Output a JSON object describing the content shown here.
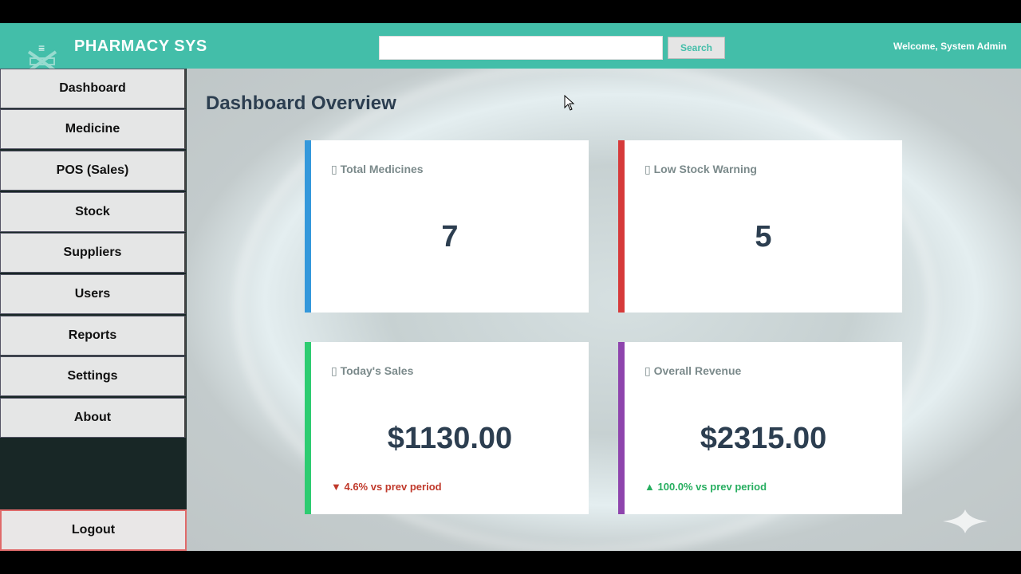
{
  "header": {
    "app_title": "PHARMACY SYS",
    "search_placeholder": "",
    "search_value": "",
    "search_label": "Search",
    "welcome": "Welcome, System Admin"
  },
  "sidebar": {
    "items": [
      {
        "label": "Dashboard"
      },
      {
        "label": "Medicine"
      },
      {
        "label": "POS (Sales)"
      },
      {
        "label": "Stock"
      },
      {
        "label": "Suppliers"
      },
      {
        "label": "Users"
      },
      {
        "label": "Reports"
      },
      {
        "label": "Settings"
      },
      {
        "label": "About"
      }
    ],
    "logout_label": "Logout"
  },
  "main": {
    "title": "Dashboard Overview",
    "cards": [
      {
        "label": "▯ Total Medicines",
        "value": "7",
        "accent": "#3498db"
      },
      {
        "label": "▯ Low Stock Warning",
        "value": "5",
        "accent": "#d63a3a"
      },
      {
        "label": "▯ Today's Sales",
        "value": "$1130.00",
        "trend": "▼ 4.6% vs prev period",
        "trend_dir": "down",
        "accent": "#2ecc71"
      },
      {
        "label": "▯ Overall Revenue",
        "value": "$2315.00",
        "trend": "▲ 100.0% vs prev period",
        "trend_dir": "up",
        "accent": "#8e44ad"
      }
    ]
  },
  "colors": {
    "header_bg": "#43bea9",
    "sidebar_bg": "#182726",
    "title_text": "#2c3e50",
    "trend_down": "#c0392b",
    "trend_up": "#27ae60"
  }
}
